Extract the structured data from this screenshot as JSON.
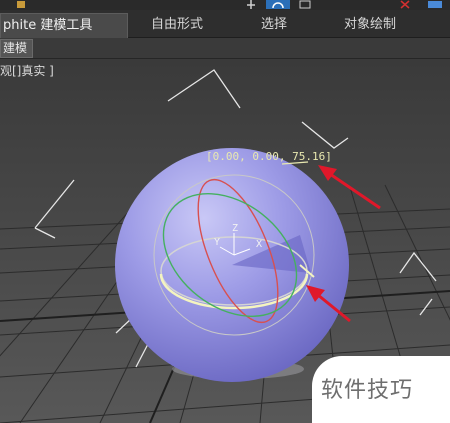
{
  "ribbon": {
    "tabs": [
      {
        "label": "phite 建模工具",
        "active": true
      },
      {
        "label": "自由形式",
        "active": false
      },
      {
        "label": "选择",
        "active": false
      },
      {
        "label": "对象绘制",
        "active": false
      }
    ],
    "subtab_label": "建模"
  },
  "viewport": {
    "label": "观[]真实 ]",
    "coord_readout": "[0.00, 0.00, 75.16]",
    "axis_labels": {
      "z": "Z",
      "y": "Y",
      "x": "X"
    }
  },
  "watermark": {
    "text": "软件技巧"
  },
  "colors": {
    "sphere": "#8f8de0",
    "arrow": "#e0182a",
    "grid": "#2c2c2c",
    "gizmo_yellow": "#e8e8b0"
  }
}
